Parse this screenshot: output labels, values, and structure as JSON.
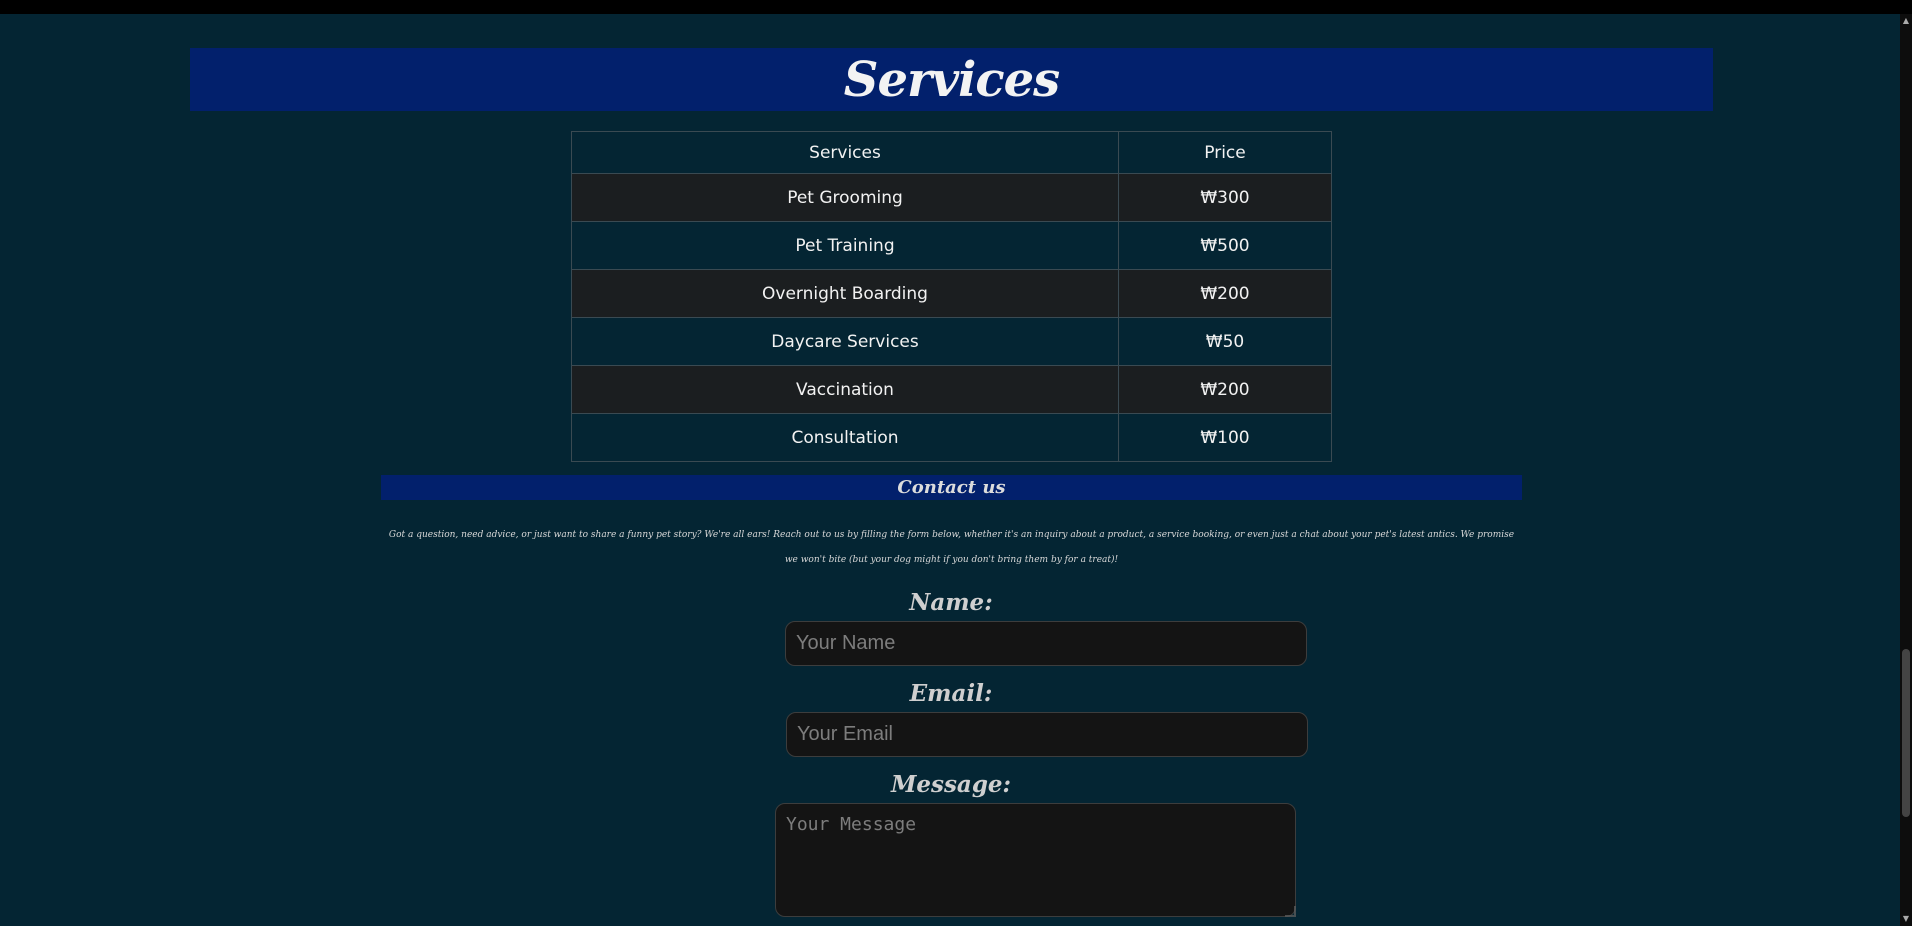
{
  "services": {
    "title": "Services",
    "table": {
      "headers": [
        "Services",
        "Price"
      ],
      "rows": [
        {
          "service": "Pet Grooming",
          "price": "₩300"
        },
        {
          "service": "Pet Training",
          "price": "₩500"
        },
        {
          "service": "Overnight Boarding",
          "price": "₩200"
        },
        {
          "service": "Daycare Services",
          "price": "₩50"
        },
        {
          "service": "Vaccination",
          "price": "₩200"
        },
        {
          "service": "Consultation",
          "price": "₩100"
        }
      ]
    }
  },
  "contact": {
    "title": "Contact us",
    "blurb": "Got a question, need advice, or just want to share a funny pet story? We're all ears! Reach out to us by filling the form below, whether it's an inquiry about a product, a service booking, or even just a chat about your pet's latest antics. We promise we won't bite (but your dog might if you don't bring them by for a treat)!",
    "form": {
      "name_label": "Name:",
      "name_placeholder": "Your Name",
      "email_label": "Email:",
      "email_placeholder": "Your Email",
      "message_label": "Message:",
      "message_placeholder": "Your Message"
    }
  },
  "colors": {
    "background": "#042533",
    "header_band": "#02206c",
    "row_alt": "#1b1e20",
    "input_bg": "#141414"
  }
}
